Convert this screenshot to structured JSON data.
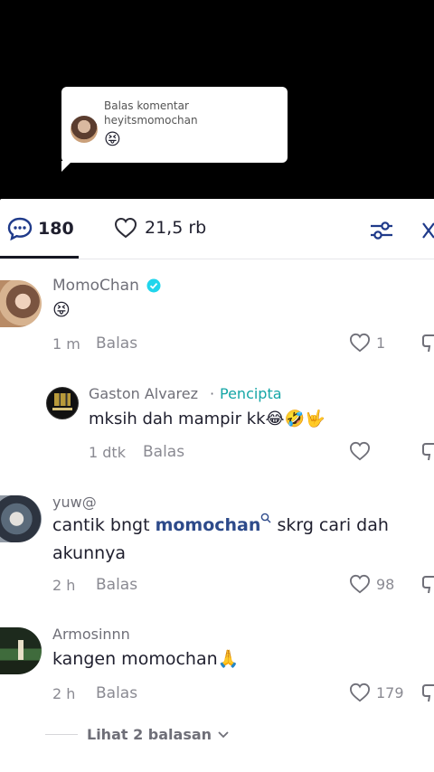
{
  "reply_bubble": {
    "line1": "Balas komentar",
    "line2": "heyitsmomochan",
    "emoji": "😝"
  },
  "tabs": {
    "comments_count": "180",
    "likes_count": "21,5 rb"
  },
  "comments": [
    {
      "name": "MomoChan",
      "verified": true,
      "text": "😝",
      "time": "1 m",
      "reply_label": "Balas",
      "likes": "1"
    },
    {
      "name": "Gaston Alvarez",
      "separator": "·",
      "badge": "Pencipta",
      "text": "mksih dah mampir kk😂🤣🤟",
      "time": "1 dtk",
      "reply_label": "Balas",
      "likes": ""
    },
    {
      "name": "yuw@",
      "text_before": "cantik bngt ",
      "mention": "momochan",
      "text_after": " skrg cari dah",
      "text_line2": "akunnya",
      "time": "2 h",
      "reply_label": "Balas",
      "likes": "98"
    },
    {
      "name": "Armosinnn",
      "text": "kangen momochan🙏",
      "time": "2 h",
      "reply_label": "Balas",
      "likes": "179"
    }
  ],
  "view_replies": "Lihat 2 balasan"
}
